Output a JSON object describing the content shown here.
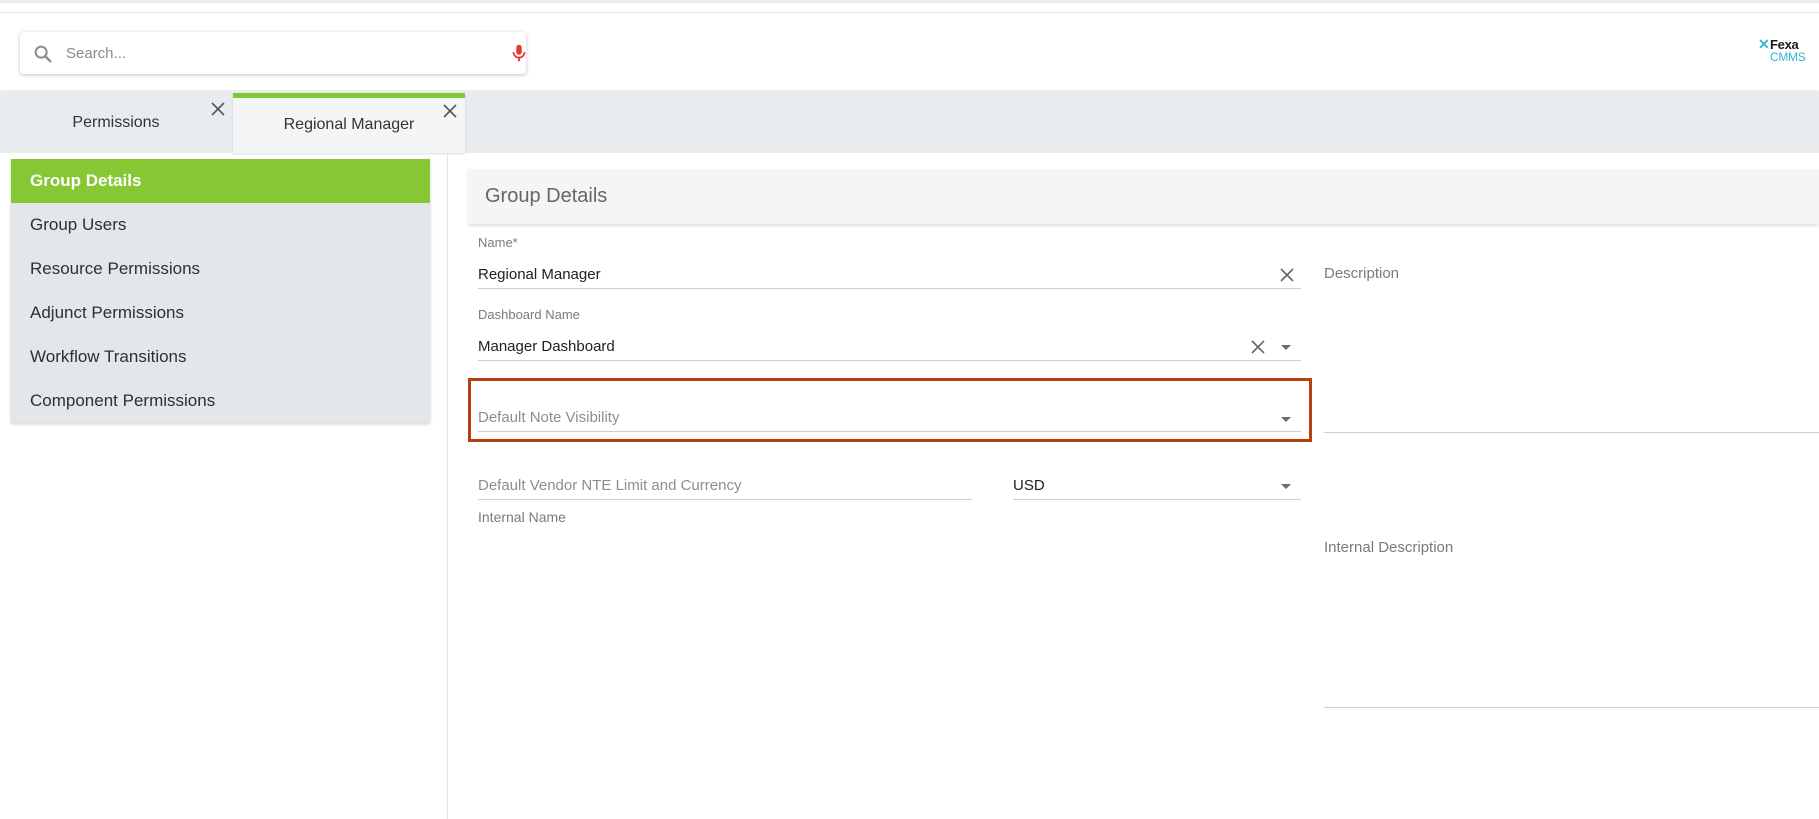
{
  "search": {
    "placeholder": "Search..."
  },
  "brand": {
    "line1": "Fexa",
    "line2": "CMMS"
  },
  "tabs": [
    {
      "label": "Permissions"
    },
    {
      "label": "Regional Manager"
    }
  ],
  "sidebar": {
    "items": [
      {
        "label": "Group Details",
        "active": true
      },
      {
        "label": "Group Users"
      },
      {
        "label": "Resource Permissions"
      },
      {
        "label": "Adjunct Permissions"
      },
      {
        "label": "Workflow Transitions"
      },
      {
        "label": "Component Permissions"
      }
    ]
  },
  "panel": {
    "title": "Group Details"
  },
  "form": {
    "name": {
      "label": "Name*",
      "value": "Regional Manager"
    },
    "dashboard": {
      "label": "Dashboard Name",
      "value": "Manager Dashboard"
    },
    "note_visibility": {
      "placeholder": "Default Note Visibility"
    },
    "vendor_nte": {
      "placeholder": "Default Vendor NTE Limit and Currency"
    },
    "currency": {
      "value": "USD"
    },
    "internal_name": {
      "label": "Internal Name"
    },
    "description": {
      "label": "Description"
    },
    "internal_description": {
      "label": "Internal Description"
    }
  },
  "colors": {
    "accent": "#87c733",
    "highlight": "#b5410f",
    "mic": "#e53935"
  }
}
